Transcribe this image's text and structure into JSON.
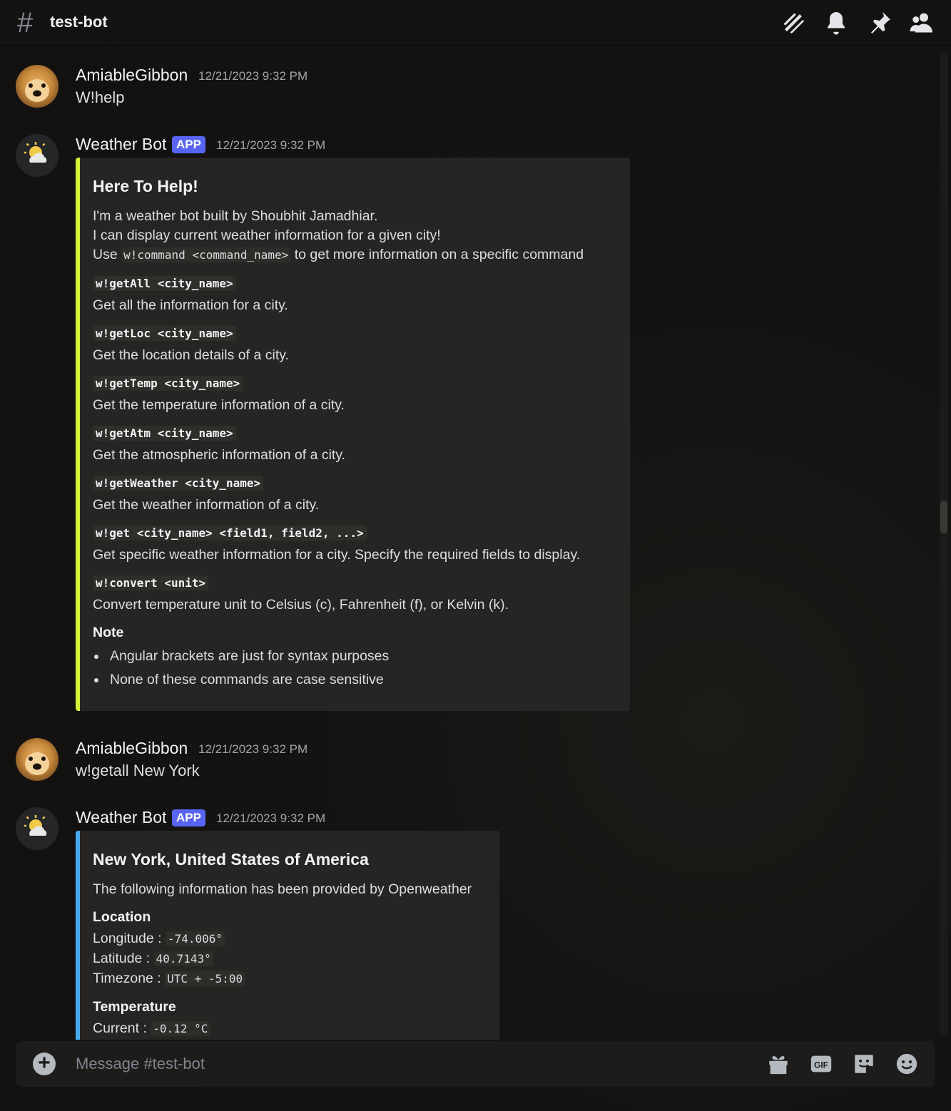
{
  "header": {
    "channel_name": "test-bot",
    "icons": [
      "threads-icon",
      "bell-icon",
      "pin-icon",
      "members-icon"
    ]
  },
  "messages": [
    {
      "author": "AmiableGibbon",
      "timestamp": "12/21/2023 9:32 PM",
      "content": "W!help"
    },
    {
      "author": "Weather Bot",
      "badge": "APP",
      "timestamp": "12/21/2023 9:32 PM",
      "embed": {
        "accent_color": "#d4f037",
        "title": "Here To Help!",
        "intro_line1": "I'm a weather bot built by Shoubhit Jamadhiar.",
        "intro_line2": "I can display current weather information for a given city!",
        "intro_line3_pre": "Use ",
        "intro_line3_code": "w!command <command_name>",
        "intro_line3_post": " to get more information on a specific command",
        "commands": [
          {
            "cmd": "w!getAll <city_name>",
            "desc": "Get all the information for a city."
          },
          {
            "cmd": "w!getLoc <city_name>",
            "desc": "Get the location details of a city."
          },
          {
            "cmd": "w!getTemp <city_name>",
            "desc": "Get the temperature information of a city."
          },
          {
            "cmd": "w!getAtm <city_name>",
            "desc": "Get the atmospheric information of a city."
          },
          {
            "cmd": "w!getWeather <city_name>",
            "desc": "Get the weather information of a city."
          },
          {
            "cmd": "w!get <city_name> <field1, field2, ...>",
            "desc": "Get specific weather information for a city. Specify the required fields to display."
          },
          {
            "cmd": "w!convert <unit>",
            "desc": "Convert temperature unit to Celsius (c), Fahrenheit (f), or Kelvin (k)."
          }
        ],
        "note_title": "Note",
        "notes": [
          "Angular brackets are just for syntax purposes",
          "None of these commands are case sensitive"
        ]
      }
    },
    {
      "author": "AmiableGibbon",
      "timestamp": "12/21/2023 9:32 PM",
      "content": "w!getall New York"
    },
    {
      "author": "Weather Bot",
      "badge": "APP",
      "timestamp": "12/21/2023 9:32 PM",
      "embed": {
        "accent_color": "#4aa8f0",
        "title": "New York, United States of America",
        "description": "The following information has been provided by Openweather",
        "location_title": "Location",
        "longitude_label": "Longitude : ",
        "longitude_value": "-74.006°",
        "latitude_label": "Latitude : ",
        "latitude_value": "40.7143°",
        "timezone_label": "Timezone : ",
        "timezone_value": "UTC + -5:00",
        "temperature_title": "Temperature",
        "current_label": "Current : ",
        "current_value": "-0.12 °C"
      }
    }
  ],
  "composer": {
    "placeholder": "Message #test-bot",
    "gif_label": "GIF"
  }
}
